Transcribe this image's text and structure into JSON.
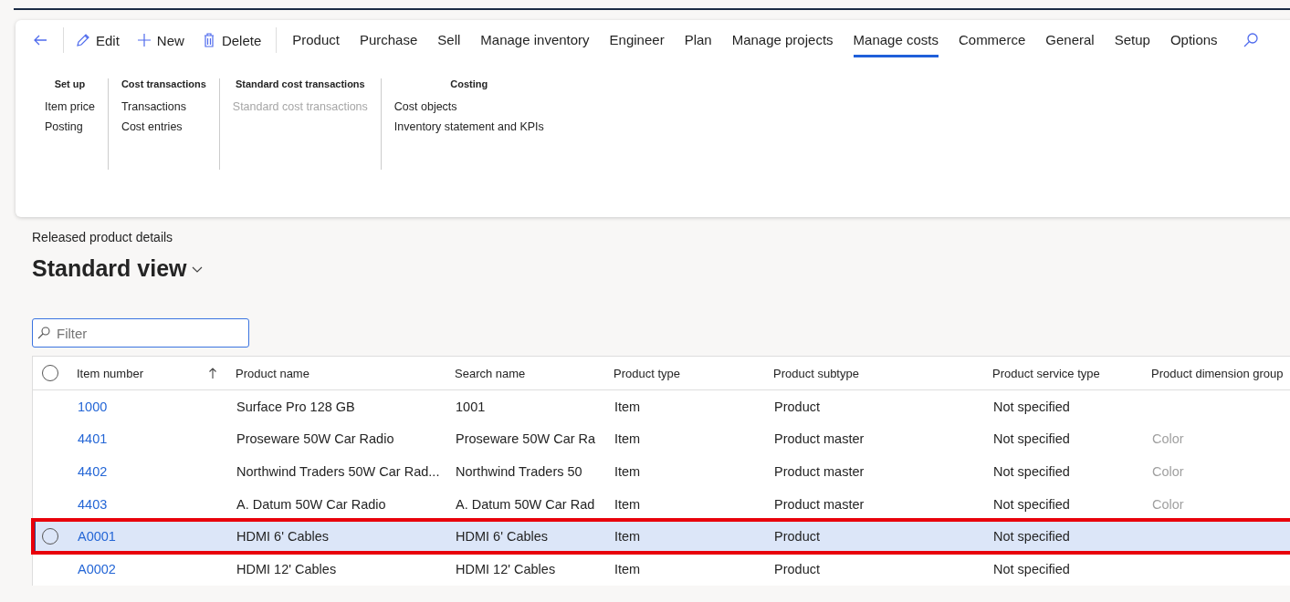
{
  "action_bar": {
    "commands": [
      {
        "kind": "back"
      },
      {
        "kind": "edit",
        "label": "Edit"
      },
      {
        "kind": "new",
        "label": "New"
      },
      {
        "kind": "delete",
        "label": "Delete"
      }
    ],
    "tabs": [
      {
        "label": "Product",
        "selected": false
      },
      {
        "label": "Purchase",
        "selected": false
      },
      {
        "label": "Sell",
        "selected": false
      },
      {
        "label": "Manage inventory",
        "selected": false
      },
      {
        "label": "Engineer",
        "selected": false
      },
      {
        "label": "Plan",
        "selected": false
      },
      {
        "label": "Manage projects",
        "selected": false
      },
      {
        "label": "Manage costs",
        "selected": true
      },
      {
        "label": "Commerce",
        "selected": false
      },
      {
        "label": "General",
        "selected": false
      },
      {
        "label": "Setup",
        "selected": false
      },
      {
        "label": "Options",
        "selected": false
      }
    ]
  },
  "ribbon_groups": [
    {
      "title": "Set up",
      "items": [
        {
          "label": "Item price",
          "disabled": false
        },
        {
          "label": "Posting",
          "disabled": false
        }
      ]
    },
    {
      "title": "Cost transactions",
      "items": [
        {
          "label": "Transactions",
          "disabled": false
        },
        {
          "label": "Cost entries",
          "disabled": false
        }
      ]
    },
    {
      "title": "Standard cost transactions",
      "items": [
        {
          "label": "Standard cost transactions",
          "disabled": true
        }
      ]
    },
    {
      "title": "Costing",
      "items": [
        {
          "label": "Cost objects",
          "disabled": false
        },
        {
          "label": "Inventory statement and KPIs",
          "disabled": false
        }
      ]
    }
  ],
  "page": {
    "caption": "Released product details",
    "view_title": "Standard view"
  },
  "filter": {
    "placeholder": "Filter"
  },
  "table": {
    "all_selected": false,
    "columns": [
      "Item number",
      "Product name",
      "Search name",
      "Product type",
      "Product subtype",
      "Product service type",
      "Product dimension group"
    ],
    "rows": [
      {
        "cells": [
          "1000",
          "Surface Pro 128 GB",
          "1001",
          "Item",
          "Product",
          "Not specified",
          ""
        ],
        "selected": false,
        "highlighted": false
      },
      {
        "cells": [
          "4401",
          "Proseware 50W Car Radio",
          "Proseware 50W Car Ra",
          "Item",
          "Product master",
          "Not specified",
          "Color"
        ],
        "selected": false,
        "highlighted": false
      },
      {
        "cells": [
          "4402",
          "Northwind Traders 50W Car Rad...",
          "Northwind Traders 50",
          "Item",
          "Product master",
          "Not specified",
          "Color"
        ],
        "selected": false,
        "highlighted": false
      },
      {
        "cells": [
          "4403",
          "A. Datum 50W Car Radio",
          "A. Datum 50W Car Rad",
          "Item",
          "Product master",
          "Not specified",
          "Color"
        ],
        "selected": false,
        "highlighted": false
      },
      {
        "cells": [
          "A0001",
          "HDMI 6' Cables",
          "HDMI 6' Cables",
          "Item",
          "Product",
          "Not specified",
          ""
        ],
        "selected": true,
        "highlighted": true
      },
      {
        "cells": [
          "A0002",
          "HDMI 12' Cables",
          "HDMI 12' Cables",
          "Item",
          "Product",
          "Not specified",
          ""
        ],
        "selected": false,
        "highlighted": false
      }
    ]
  }
}
